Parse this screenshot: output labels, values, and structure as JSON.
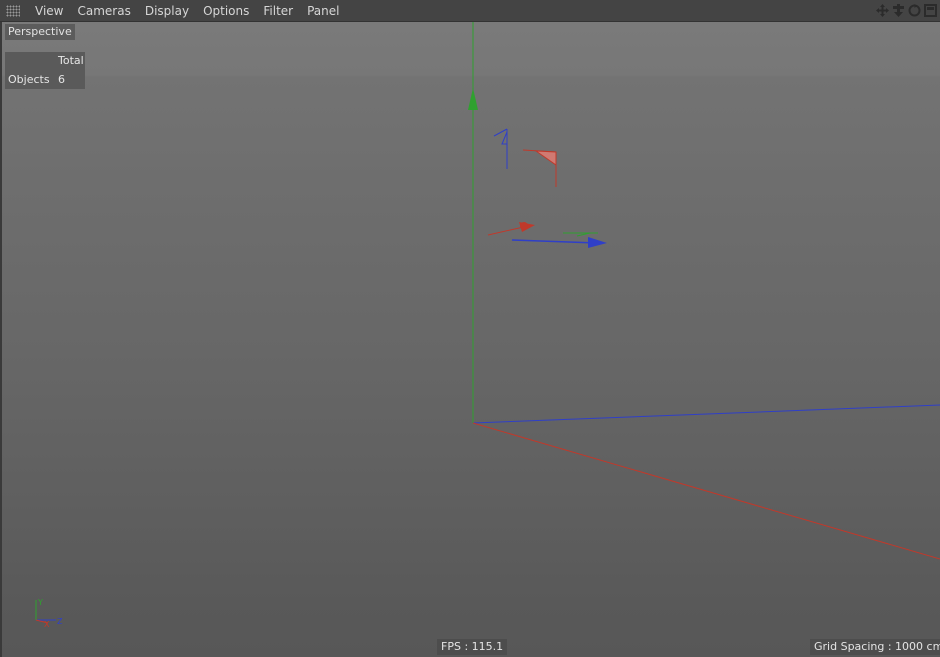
{
  "menubar": {
    "items": [
      "View",
      "Cameras",
      "Display",
      "Options",
      "Filter",
      "Panel"
    ],
    "nav_icons": [
      "move-view-icon",
      "drag-view-icon",
      "rotate-view-icon",
      "maximize-view-icon"
    ]
  },
  "viewport": {
    "camera_label": "Perspective",
    "stats": {
      "column_header": "Total",
      "row_label": "Objects",
      "row_value": "6"
    },
    "fps": "FPS : 115.1",
    "grid_spacing": "Grid Spacing : 1000 cm",
    "axis_indicator_labels": [
      "Y",
      "X",
      "Z"
    ],
    "colors": {
      "x_axis": "#c0392b",
      "y_axis": "#2fa12f",
      "z_axis": "#2f3fc8"
    }
  }
}
